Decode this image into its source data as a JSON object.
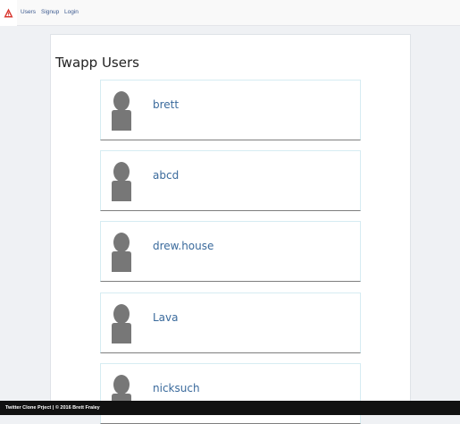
{
  "nav": {
    "logo_icon": "red-triangle-logo",
    "links": [
      {
        "label": "Users"
      },
      {
        "label": "Signup"
      },
      {
        "label": "Login"
      }
    ]
  },
  "main": {
    "title": "Twapp Users",
    "users": [
      {
        "name": "brett",
        "avatar_icon": "default-user-icon"
      },
      {
        "name": "abcd",
        "avatar_icon": "default-user-icon"
      },
      {
        "name": "drew.house",
        "avatar_icon": "default-user-icon"
      },
      {
        "name": "Lava",
        "avatar_icon": "default-user-icon"
      },
      {
        "name": "nicksuch",
        "avatar_icon": "default-user-icon"
      }
    ]
  },
  "footer": {
    "text": "Twitter Clone Prject | © 2016 Brett Fraley"
  },
  "colors": {
    "logo": "#d93a32",
    "link": "#3a6a9c",
    "avatar": "#777777",
    "footer_bg": "#111111"
  }
}
